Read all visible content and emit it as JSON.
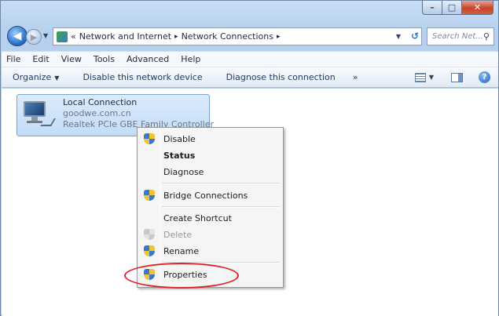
{
  "window": {
    "caption_buttons": [
      "minimize-icon",
      "maximize-icon",
      "close-icon"
    ]
  },
  "address_bar": {
    "prefix": "«",
    "crumbs": [
      "Network and Internet",
      "Network Connections"
    ],
    "separator": "▸",
    "search_placeholder": "Search Net..."
  },
  "menu": [
    "File",
    "Edit",
    "View",
    "Tools",
    "Advanced",
    "Help"
  ],
  "commands": {
    "organize": "Organize",
    "disable": "Disable this network device",
    "diagnose": "Diagnose this connection",
    "more": "»"
  },
  "connection": {
    "name": "Local Connection",
    "domain": "goodwe.com.cn",
    "adapter": "Realtek PCIe GBE Family Controller"
  },
  "context_menu": [
    {
      "label": "Disable",
      "shield": true,
      "bold": false,
      "disabled": false
    },
    {
      "label": "Status",
      "shield": false,
      "bold": true,
      "disabled": false
    },
    {
      "label": "Diagnose",
      "shield": false,
      "bold": false,
      "disabled": false
    },
    {
      "label": "Bridge Connections",
      "shield": true,
      "bold": false,
      "disabled": false
    },
    {
      "label": "Create Shortcut",
      "shield": false,
      "bold": false,
      "disabled": false
    },
    {
      "label": "Delete",
      "shield": true,
      "bold": false,
      "disabled": true
    },
    {
      "label": "Rename",
      "shield": true,
      "bold": false,
      "disabled": false
    },
    {
      "label": "Properties",
      "shield": true,
      "bold": false,
      "disabled": false
    }
  ],
  "highlight": {
    "target": "Properties",
    "color": "#d9262c"
  }
}
